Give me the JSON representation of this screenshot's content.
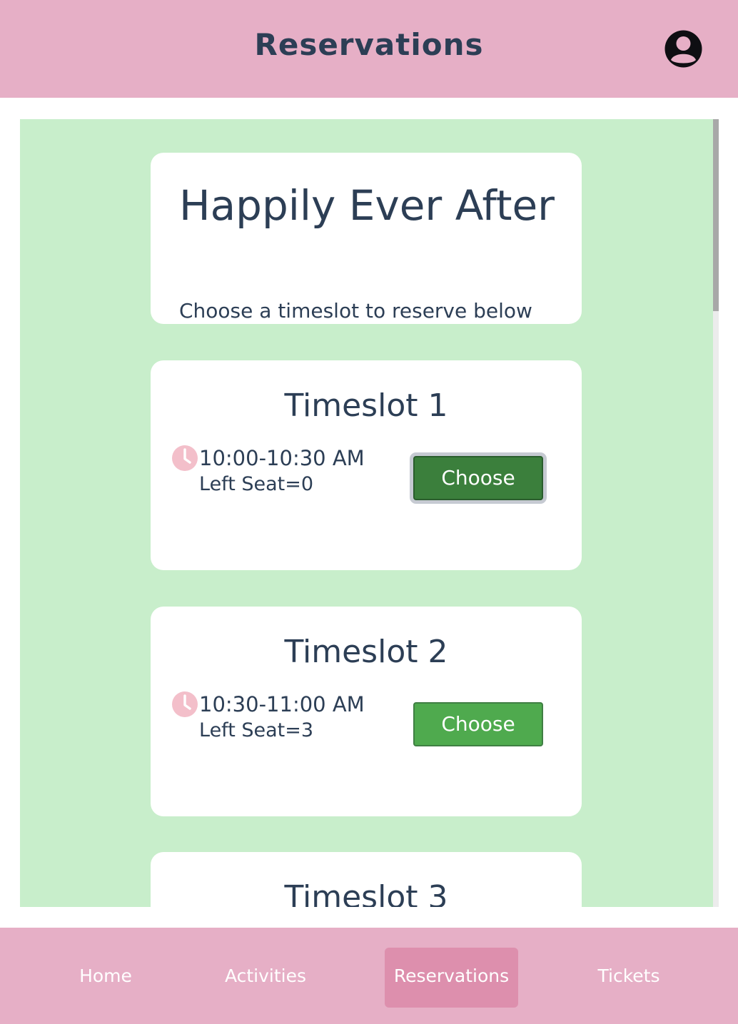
{
  "header": {
    "title": "Reservations",
    "avatar_icon": "user-circle-icon"
  },
  "hero": {
    "title": "Happily Ever After",
    "subtitle": "Choose a timeslot to reserve below"
  },
  "timeslots": [
    {
      "title": "Timeslot 1",
      "time": "10:00-10:30 AM",
      "seats": "Left Seat=0",
      "button_label": "Choose",
      "icon": "clock-icon",
      "selected": true
    },
    {
      "title": "Timeslot 2",
      "time": "10:30-11:00 AM",
      "seats": "Left Seat=3",
      "button_label": "Choose",
      "icon": "clock-icon",
      "selected": false
    },
    {
      "title": "Timeslot 3"
    }
  ],
  "bottom_nav": {
    "items": [
      {
        "label": "Home"
      },
      {
        "label": "Activities"
      },
      {
        "label": "Reservations",
        "active": true
      },
      {
        "label": "Tickets"
      }
    ]
  },
  "colors": {
    "header_bg": "#e6afc6",
    "content_bg": "#c8eecb",
    "text": "#2c3e55",
    "button_green": "#4faa4e",
    "button_green_selected": "#3b7f3c",
    "nav_active": "#dd8fad",
    "clock": "#f3bfca"
  }
}
